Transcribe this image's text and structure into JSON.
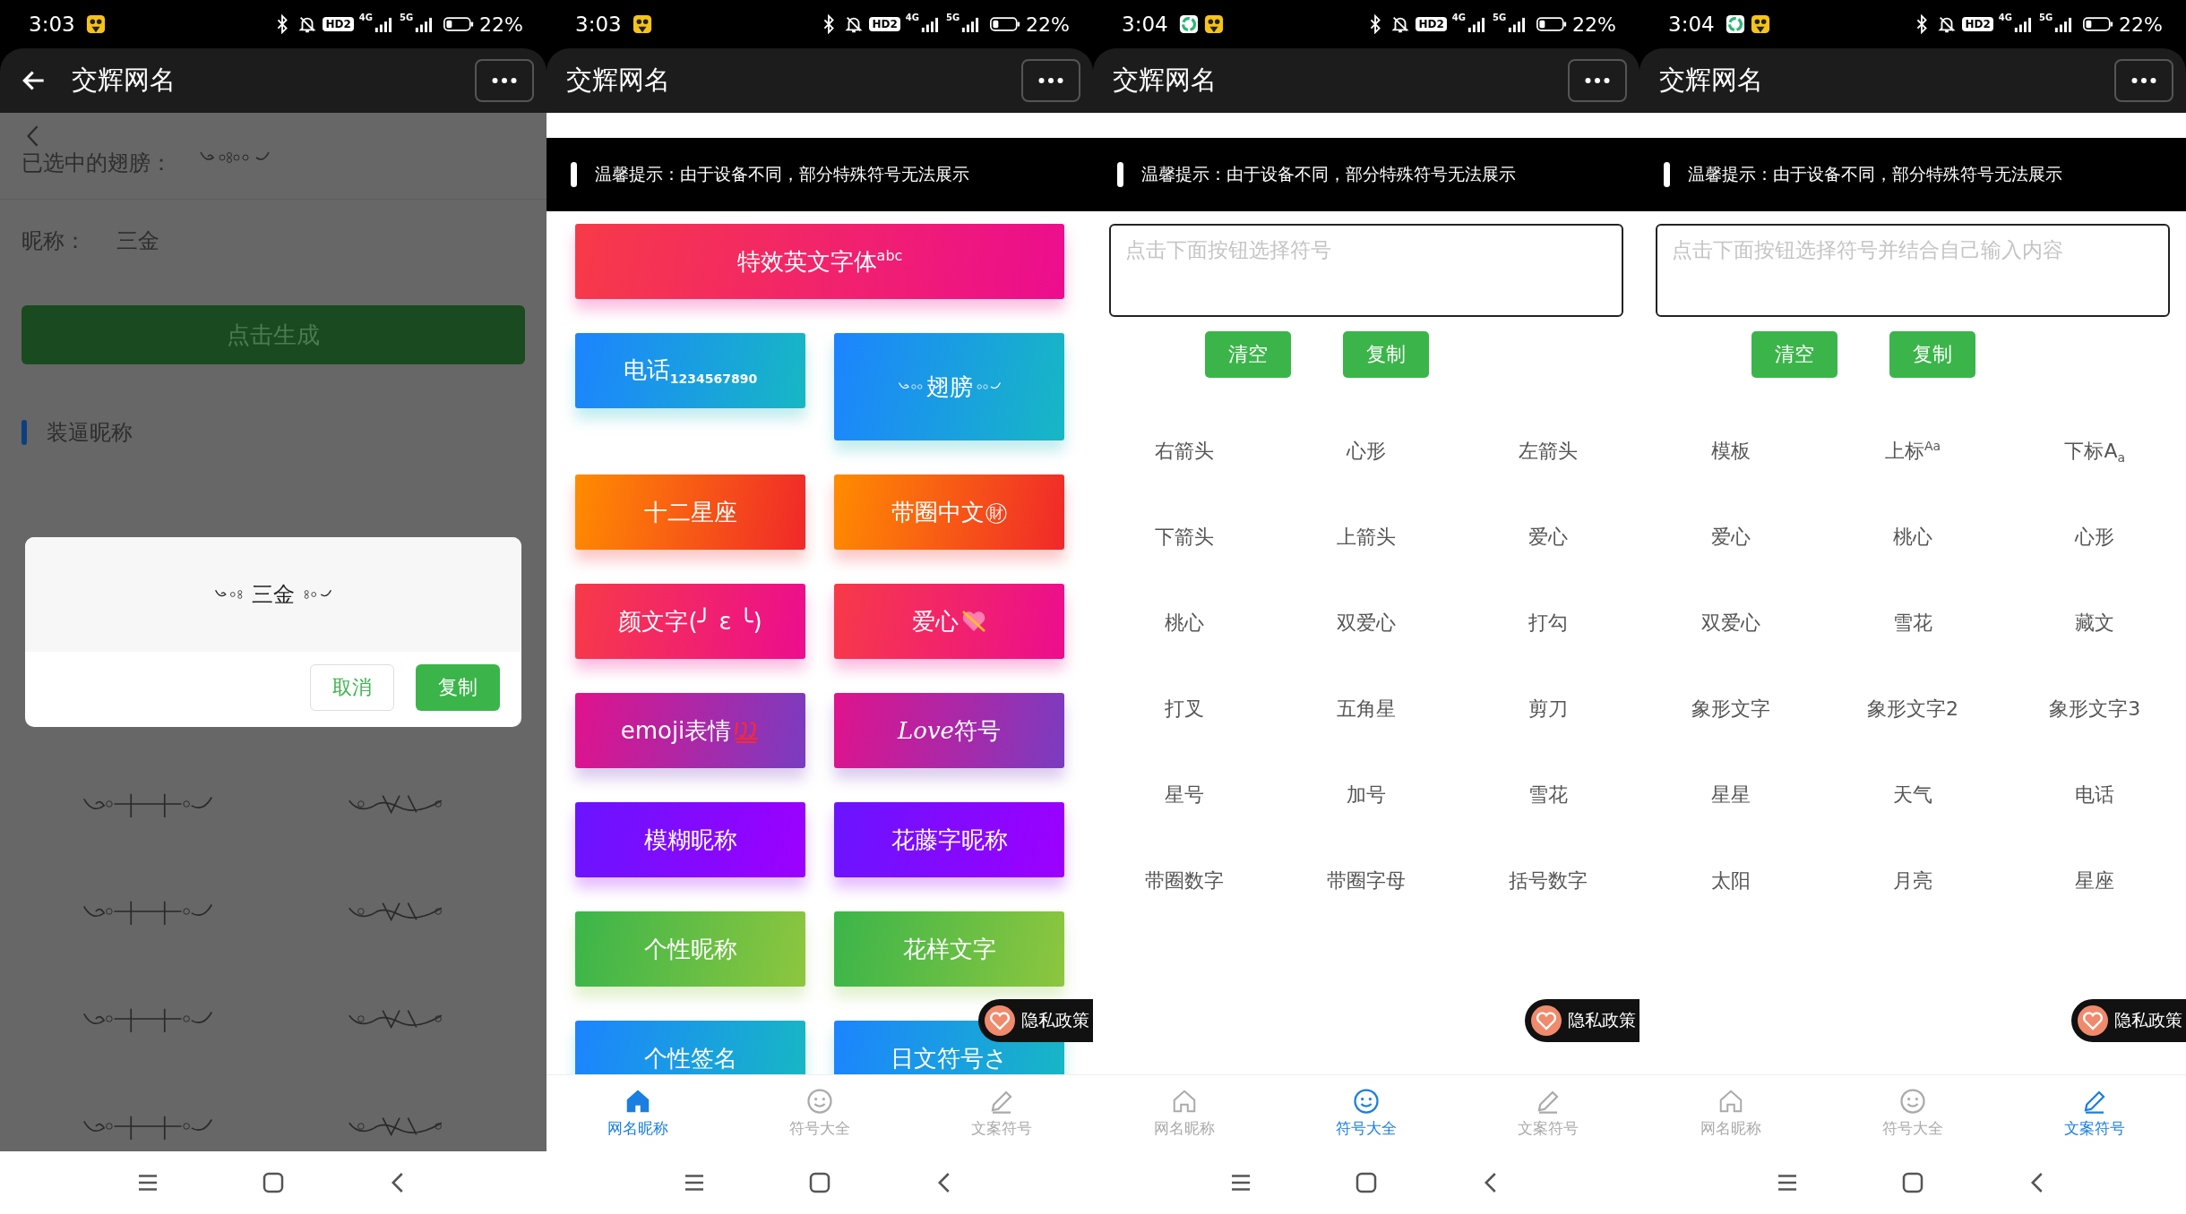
{
  "panels": [
    {
      "kind": "detail",
      "status_bar": {
        "time": "3:03",
        "app_icons": [
          {
            "kind": "cat"
          }
        ],
        "hd": "HD2",
        "networks": [
          "4G",
          "5G"
        ],
        "battery": "22%"
      },
      "header": {
        "title": "交辉网名",
        "back": true
      },
      "selected_label": "已选中的翅膀：",
      "nickname_label": "昵称：",
      "nickname": "三金",
      "generate_button": "点击生成",
      "section_title": "装逼昵称",
      "dialog": {
        "text": "三金",
        "buttons": [
          {
            "label": "取消",
            "kind": "secondary"
          },
          {
            "label": "复制",
            "kind": "primary"
          }
        ]
      }
    },
    {
      "kind": "categories",
      "status_bar": {
        "time": "3:03",
        "app_icons": [
          {
            "kind": "cat"
          }
        ],
        "hd": "HD2",
        "networks": [
          "4G",
          "5G"
        ],
        "battery": "22%"
      },
      "header": {
        "title": "交辉网名",
        "back": false
      },
      "tip": "温馨提示：由于设备不同，部分特殊符号无法展示",
      "category_buttons": [
        {
          "label": "特效英文字体$^{abc}$",
          "color": "#f73a48",
          "wide": true,
          "kind": "text"
        },
        {
          "label": "电话$_{1234567890}$",
          "color": "#1c84ff",
          "wide": false,
          "kind": "text"
        },
        {
          "label": "翅膀",
          "color": "#1c84ff",
          "wide": false,
          "kind": "wings"
        },
        {
          "label": "十二星座",
          "color": "#ff8c00",
          "wide": false,
          "kind": "text"
        },
        {
          "label": "带圈中文㊖",
          "color": "#ff8c00",
          "wide": false,
          "kind": "text"
        },
        {
          "label": "颜文字(╯ ε ╰)",
          "color": "#f73a48",
          "wide": false,
          "kind": "text"
        },
        {
          "label": "爱心",
          "color": "#f73a48",
          "wide": false,
          "kind": "heart"
        },
        {
          "label": "emoji表情",
          "color": "#e0128c",
          "wide": false,
          "kind": "hundred"
        },
        {
          "label": "Love符号",
          "color": "#e0128c",
          "wide": false,
          "kind": "script"
        },
        {
          "label": "模糊昵称",
          "color": "#6a14ff",
          "wide": false,
          "kind": "text"
        },
        {
          "label": "花藤字昵称",
          "color": "#6a14ff",
          "wide": false,
          "kind": "text"
        },
        {
          "label": "个性昵称",
          "color": "#3bb54a",
          "wide": false,
          "kind": "text"
        },
        {
          "label": "花样文字",
          "color": "#3bb54a",
          "wide": false,
          "kind": "text"
        },
        {
          "label": "个性签名",
          "color": "#1c84ff",
          "wide": false,
          "kind": "text"
        },
        {
          "label": "日文符号さ",
          "color": "#1c84ff",
          "wide": false,
          "kind": "text"
        }
      ],
      "privacy": "隐私政策",
      "tabs": [
        {
          "label": "网名昵称",
          "kind": "home",
          "selected": true
        },
        {
          "label": "符号大全",
          "kind": "smile",
          "selected": false
        },
        {
          "label": "文案符号",
          "kind": "pencil",
          "selected": false
        }
      ]
    },
    {
      "kind": "symbols",
      "status_bar": {
        "time": "3:04",
        "app_icons": [
          {
            "kind": "sync"
          },
          {
            "kind": "cat"
          }
        ],
        "hd": "HD2",
        "networks": [
          "4G",
          "5G"
        ],
        "battery": "22%"
      },
      "header": {
        "title": "交辉网名",
        "back": false
      },
      "tip": "温馨提示：由于设备不同，部分特殊符号无法展示",
      "input": {
        "placeholder": "点击下面按钮选择符号"
      },
      "actions": [
        "清空",
        "复制"
      ],
      "symbol_items": [
        "右箭头",
        "心形",
        "左箭头",
        "下箭头",
        "上箭头",
        "爱心",
        "桃心",
        "双爱心",
        "打勾",
        "打叉",
        "五角星",
        "剪刀",
        "星号",
        "加号",
        "雪花",
        "带圈数字",
        "带圈字母",
        "括号数字"
      ],
      "privacy": "隐私政策",
      "tabs": [
        {
          "label": "网名昵称",
          "kind": "home",
          "selected": false
        },
        {
          "label": "符号大全",
          "kind": "smile",
          "selected": true
        },
        {
          "label": "文案符号",
          "kind": "pencil",
          "selected": false
        }
      ]
    },
    {
      "kind": "symbols",
      "status_bar": {
        "time": "3:04",
        "app_icons": [
          {
            "kind": "sync"
          },
          {
            "kind": "cat"
          }
        ],
        "hd": "HD2",
        "networks": [
          "4G",
          "5G"
        ],
        "battery": "22%"
      },
      "header": {
        "title": "交辉网名",
        "back": false
      },
      "tip": "温馨提示：由于设备不同，部分特殊符号无法展示",
      "input": {
        "placeholder": "点击下面按钮选择符号并结合自己输入内容"
      },
      "actions": [
        "清空",
        "复制"
      ],
      "symbol_items": [
        "模板",
        "上标$^{Aa}$",
        "下标A$_{a}$",
        "爱心",
        "桃心",
        "心形",
        "双爱心",
        "雪花",
        "藏文",
        "象形文字",
        "象形文字2",
        "象形文字3",
        "星星",
        "天气",
        "电话",
        "太阳",
        "月亮",
        "星座"
      ],
      "privacy": "隐私政策",
      "tabs": [
        {
          "label": "网名昵称",
          "kind": "home",
          "selected": false
        },
        {
          "label": "符号大全",
          "kind": "smile",
          "selected": false
        },
        {
          "label": "文案符号",
          "kind": "pencil",
          "selected": true
        }
      ]
    }
  ]
}
